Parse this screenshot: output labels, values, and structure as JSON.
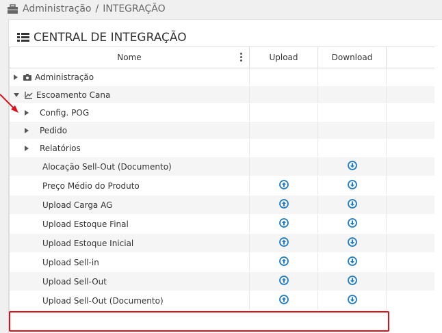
{
  "breadcrumb": {
    "root": "Administração",
    "separator": "/",
    "current": "INTEGRAÇÃO",
    "icon": "briefcase-icon"
  },
  "panel": {
    "title": "CENTRAL DE INTEGRAÇÃO",
    "icon": "list-icon"
  },
  "grid": {
    "columns": {
      "name": "Nome",
      "upload": "Upload",
      "download": "Download"
    },
    "rows": [
      {
        "label": "Administração",
        "level": 0,
        "expander": "collapsed",
        "icon": "camera-icon",
        "upload": false,
        "download": false
      },
      {
        "label": "Escoamento Cana",
        "level": 0,
        "expander": "expanded",
        "icon": "line-chart-icon",
        "upload": false,
        "download": false
      },
      {
        "label": "Config. POG",
        "level": 1,
        "expander": "collapsed",
        "upload": false,
        "download": false
      },
      {
        "label": "Pedido",
        "level": 1,
        "expander": "collapsed",
        "upload": false,
        "download": false
      },
      {
        "label": "Relatórios",
        "level": 1,
        "expander": "collapsed",
        "upload": false,
        "download": false
      },
      {
        "label": "Alocação Sell-Out (Documento)",
        "level": 2,
        "upload": false,
        "download": true
      },
      {
        "label": "Preço Médio do Produto",
        "level": 2,
        "upload": true,
        "download": true
      },
      {
        "label": "Upload Carga AG",
        "level": 2,
        "upload": true,
        "download": true
      },
      {
        "label": "Upload Estoque Final",
        "level": 2,
        "upload": true,
        "download": true
      },
      {
        "label": "Upload Estoque Inicial",
        "level": 2,
        "upload": true,
        "download": true
      },
      {
        "label": "Upload Sell-in",
        "level": 2,
        "upload": true,
        "download": true
      },
      {
        "label": "Upload Sell-Out",
        "level": 2,
        "upload": true,
        "download": true
      },
      {
        "label": "Upload Sell-Out (Documento)",
        "level": 2,
        "upload": true,
        "download": true,
        "highlighted": true
      }
    ]
  },
  "colors": {
    "accent": "#1e7bc4",
    "highlight": "#e0101a",
    "alt_row": "#f5f5f5"
  }
}
